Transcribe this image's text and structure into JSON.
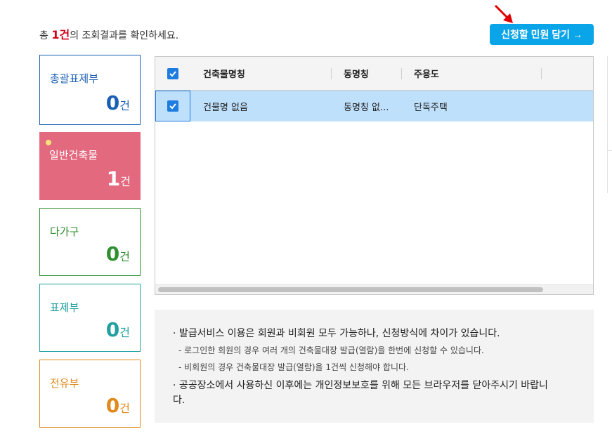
{
  "summary": {
    "prefix": "총 ",
    "count": "1건",
    "suffix": "의 조회결과를 확인하세요."
  },
  "cart_button": {
    "label": "신청할 민원 담기 →"
  },
  "cards": [
    {
      "label": "총괄표제부",
      "count": "0",
      "unit": "건",
      "color": "#1a5fb4"
    },
    {
      "label": "일반건축물",
      "count": "1",
      "unit": "건",
      "color": "#e3697f"
    },
    {
      "label": "다가구",
      "count": "0",
      "unit": "건",
      "color": "#2f8f2f"
    },
    {
      "label": "표제부",
      "count": "0",
      "unit": "건",
      "color": "#22a0a0"
    },
    {
      "label": "전유부",
      "count": "0",
      "unit": "건",
      "color": "#e08a1e"
    }
  ],
  "grid": {
    "columns": [
      "건축물명칭",
      "동명칭",
      "주용도"
    ],
    "rows": [
      {
        "checked": true,
        "building_name": "건물명 없음",
        "dong_name": "동명칭 없...",
        "main_use": "단독주택"
      }
    ],
    "header_checked": true
  },
  "notice": {
    "line1": "· 발급서비스 이용은 회원과 비회원 모두 가능하나, 신청방식에 차이가 있습니다.",
    "sub1": "- 로그인한 회원의 경우 여러 개의 건축물대장 발급(열람)을 한번에 신청할 수 있습니다.",
    "sub2": "- 비회원의 경우 건축물대장 발급(열람)을 1건씩 신청해야 합니다.",
    "line2": "· 공공장소에서 사용하신 이후에는 개인정보보호를 위해 모든 브라우저를 닫아주시기 바랍니다."
  },
  "colors": {
    "accent": "#0aa4e8",
    "row_selected": "#bfe0fb",
    "checkbox": "#1e7be0",
    "arrow": "#e00000"
  }
}
